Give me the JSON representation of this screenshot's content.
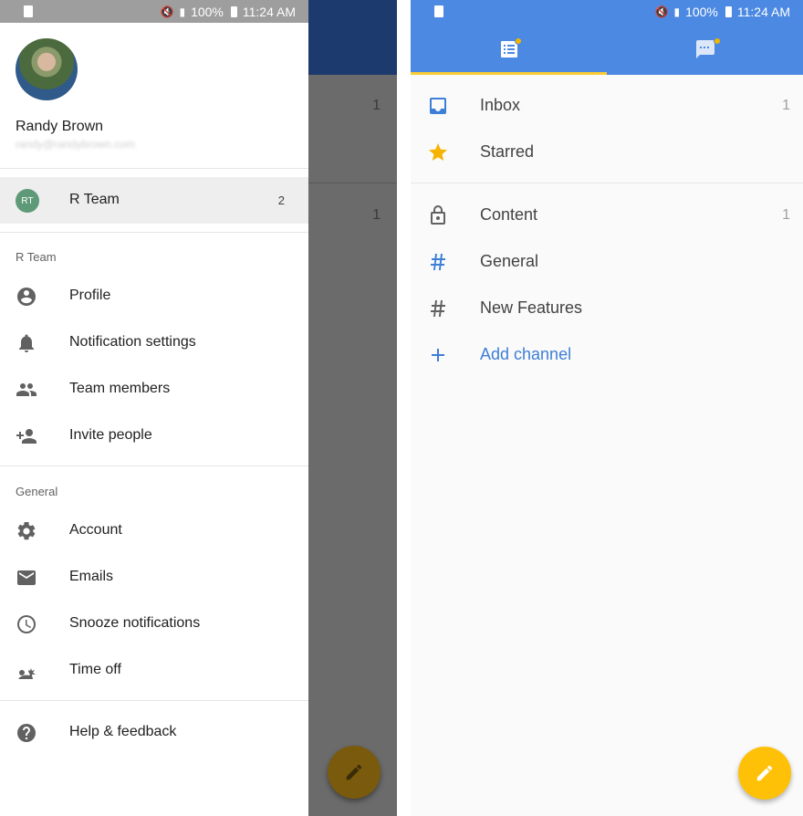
{
  "status_bar": {
    "battery": "100%",
    "time": "11:24 AM"
  },
  "background_app": {
    "counts": [
      "1",
      "1"
    ]
  },
  "drawer": {
    "user": {
      "name": "Randy Brown",
      "email": "randy@randybrown.com"
    },
    "team": {
      "initials": "RT",
      "name": "R Team",
      "count": "2"
    },
    "team_section": {
      "label": "R Team",
      "items": [
        {
          "label": "Profile",
          "icon": "account-circle-icon"
        },
        {
          "label": "Notification settings",
          "icon": "bell-icon"
        },
        {
          "label": "Team members",
          "icon": "people-icon"
        },
        {
          "label": "Invite people",
          "icon": "person-add-icon"
        }
      ]
    },
    "general_section": {
      "label": "General",
      "items": [
        {
          "label": "Account",
          "icon": "gear-icon"
        },
        {
          "label": "Emails",
          "icon": "mail-icon"
        },
        {
          "label": "Snooze notifications",
          "icon": "clock-icon"
        },
        {
          "label": "Time off",
          "icon": "beach-icon"
        }
      ]
    },
    "help": {
      "label": "Help & feedback",
      "icon": "help-icon"
    }
  },
  "channels": {
    "tabs": [
      {
        "name": "channels-tab",
        "icon": "list-icon",
        "selected": true,
        "has_dot": true
      },
      {
        "name": "messages-tab",
        "icon": "chat-icon",
        "selected": false,
        "has_dot": true
      }
    ],
    "top_items": [
      {
        "label": "Inbox",
        "count": "1",
        "icon": "inbox-icon"
      },
      {
        "label": "Starred",
        "count": "",
        "icon": "star-icon"
      }
    ],
    "channel_items": [
      {
        "label": "Content",
        "count": "1",
        "icon": "lock-icon"
      },
      {
        "label": "General",
        "count": "",
        "icon": "hash-icon"
      },
      {
        "label": "New Features",
        "count": "",
        "icon": "hash-icon"
      }
    ],
    "add_channel": {
      "label": "Add channel",
      "icon": "plus-icon"
    }
  },
  "colors": {
    "primary": "#4b89e2",
    "accent": "#ffc107",
    "link": "#3d7fd6",
    "team_badge": "#5f9a78"
  }
}
